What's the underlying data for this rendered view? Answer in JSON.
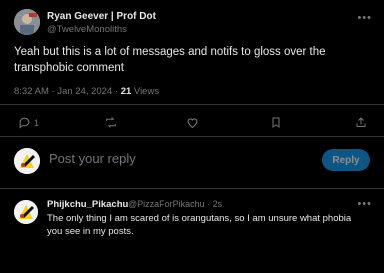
{
  "tweet": {
    "author_name": "Ryan Geever | Prof Dot",
    "author_handle": "@TwelveMonoliths",
    "more_icon": "more-icon",
    "text": "Yeah but this is a lot of messages and notifs to gloss over the transphobic comment",
    "time": "8:32 AM · Jan 24, 2024 · ",
    "views_count": "21",
    "views_label": " Views",
    "actions": {
      "reply_count": "1"
    }
  },
  "composer": {
    "placeholder": "Post your reply",
    "button_label": "Reply",
    "accent_color": "#1d9bf0"
  },
  "reply": {
    "author_name": "Phijkchu_Pikachu",
    "author_handle": "@PizzaForPikachu · 2s",
    "more_icon": "more-icon",
    "text": "The only thing I am scared of is orangutans, so I am unsure what phobia you see in my posts."
  }
}
